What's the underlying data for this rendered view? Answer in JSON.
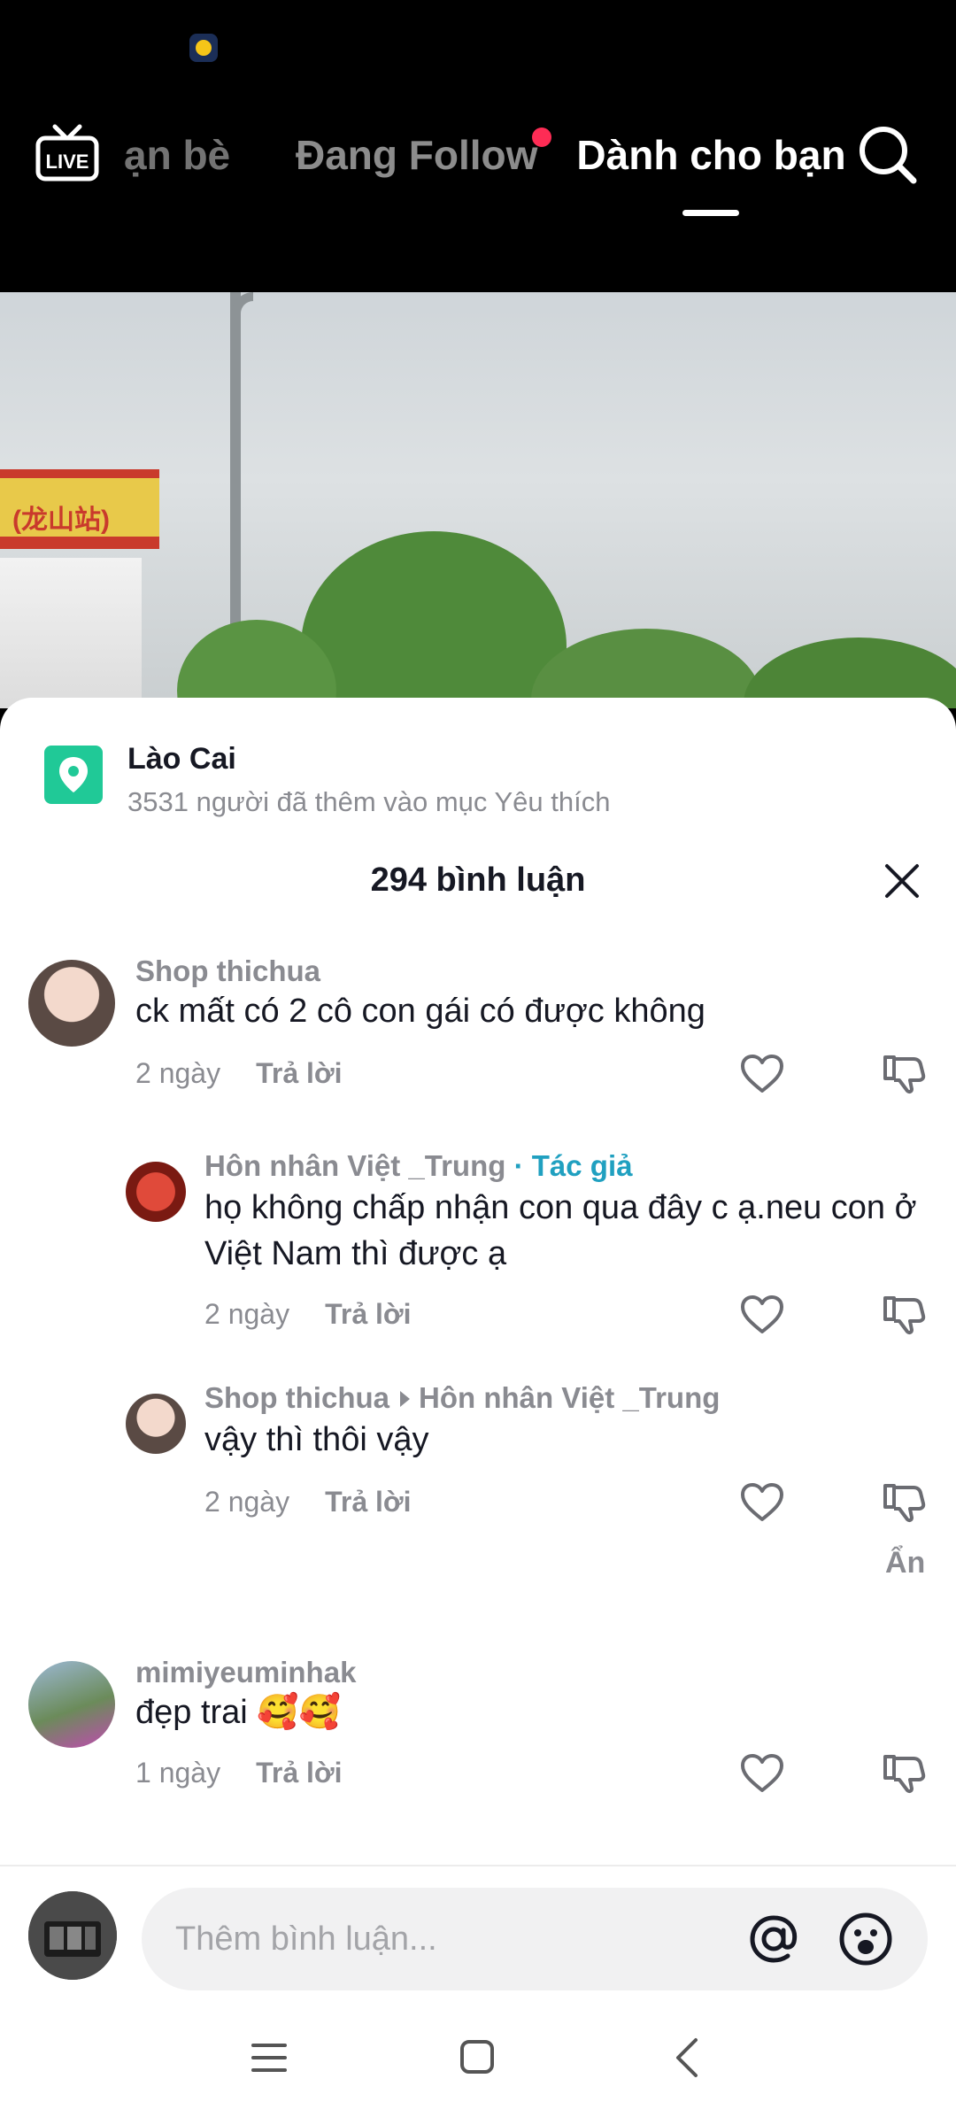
{
  "topbar": {
    "live_label": "LIVE",
    "tabs": [
      "ạn bè",
      "Đang Follow",
      "Dành cho bạn"
    ],
    "active_tab": "Dành cho bạn"
  },
  "video": {
    "station_sign": "(龙山站)"
  },
  "location": {
    "name": "Lào Cai",
    "favorites_text": "3531 người đã thêm vào mục Yêu thích"
  },
  "comments_panel": {
    "title": "294 bình luận",
    "reply_label": "Trả lời",
    "hide_label": "Ẩn",
    "author_badge": "· Tác giả",
    "comments": [
      {
        "user": "Shop thichua",
        "text": "ck mất có 2 cô con gái có được không",
        "time": "2 ngày"
      },
      {
        "user": "Hôn nhân Việt _Trung",
        "text": "họ không chấp nhận con qua đây c ạ.neu con ở Việt Nam thì được ạ",
        "time": "2 ngày"
      },
      {
        "user": "Shop thichua",
        "reply_to": "Hôn nhân Việt _Trung",
        "text": "vậy thì thôi vậy",
        "time": "2 ngày"
      },
      {
        "user": "mimiyeuminhak",
        "text": "đẹp trai 🥰🥰",
        "time": "1 ngày"
      }
    ]
  },
  "input": {
    "placeholder": "Thêm bình luận..."
  },
  "colors": {
    "accent_author": "#20a0c0",
    "notification_dot": "#fe2c55",
    "location_icon": "#20c997"
  }
}
